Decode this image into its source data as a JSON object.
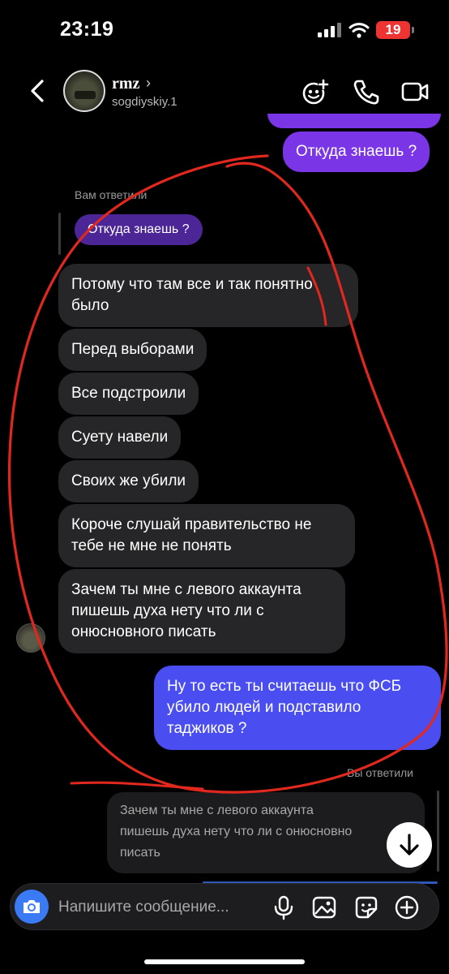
{
  "status_bar": {
    "time": "23:19",
    "battery": "19"
  },
  "header": {
    "name": "rmz",
    "username": "sogdiyskiy.1"
  },
  "messages": {
    "out_top": "Откуда знаешь ?",
    "reply_label_1": "Вам ответили",
    "quote_1": "Откуда знаешь ?",
    "in_1": [
      "Потому что там все и так понятно",
      "было"
    ],
    "in_2": "Перед выборами",
    "in_3": "Все подстроили",
    "in_4": "Суету навели",
    "in_5": "Своих же убили",
    "in_6": [
      "Короче слушай правительство не",
      "тебе не мне не понять"
    ],
    "in_7": [
      "Зачем ты мне с левого аккаунта",
      "пишешь духа нету что ли с",
      "онюсновного писать"
    ],
    "out_2": [
      "Ну то есть ты считаешь что ФСБ",
      "убило людей и подставило",
      "таджиков ?"
    ],
    "reply_label_2": "Вы ответили",
    "quote_2": [
      "Зачем ты мне с левого аккаунта",
      "пишешь духа нету что ли с онюсновно",
      "писать"
    ]
  },
  "composer": {
    "placeholder": "Напишите сообщение..."
  },
  "icons": {
    "back": "chevron-left-icon",
    "add_people": "add-people-icon",
    "call": "phone-icon",
    "video": "video-icon",
    "camera": "camera-icon",
    "mic": "microphone-icon",
    "gallery": "gallery-icon",
    "sticker": "sticker-icon",
    "plus": "plus-icon",
    "scroll_down": "arrow-down-icon"
  },
  "colors": {
    "background": "#000000",
    "incoming_bubble": "#262628",
    "outgoing_purple": "#7a35e6",
    "outgoing_blue": "#4a4ef0",
    "camera_button": "#3a7bf5",
    "annotation_red": "#e0281e"
  }
}
